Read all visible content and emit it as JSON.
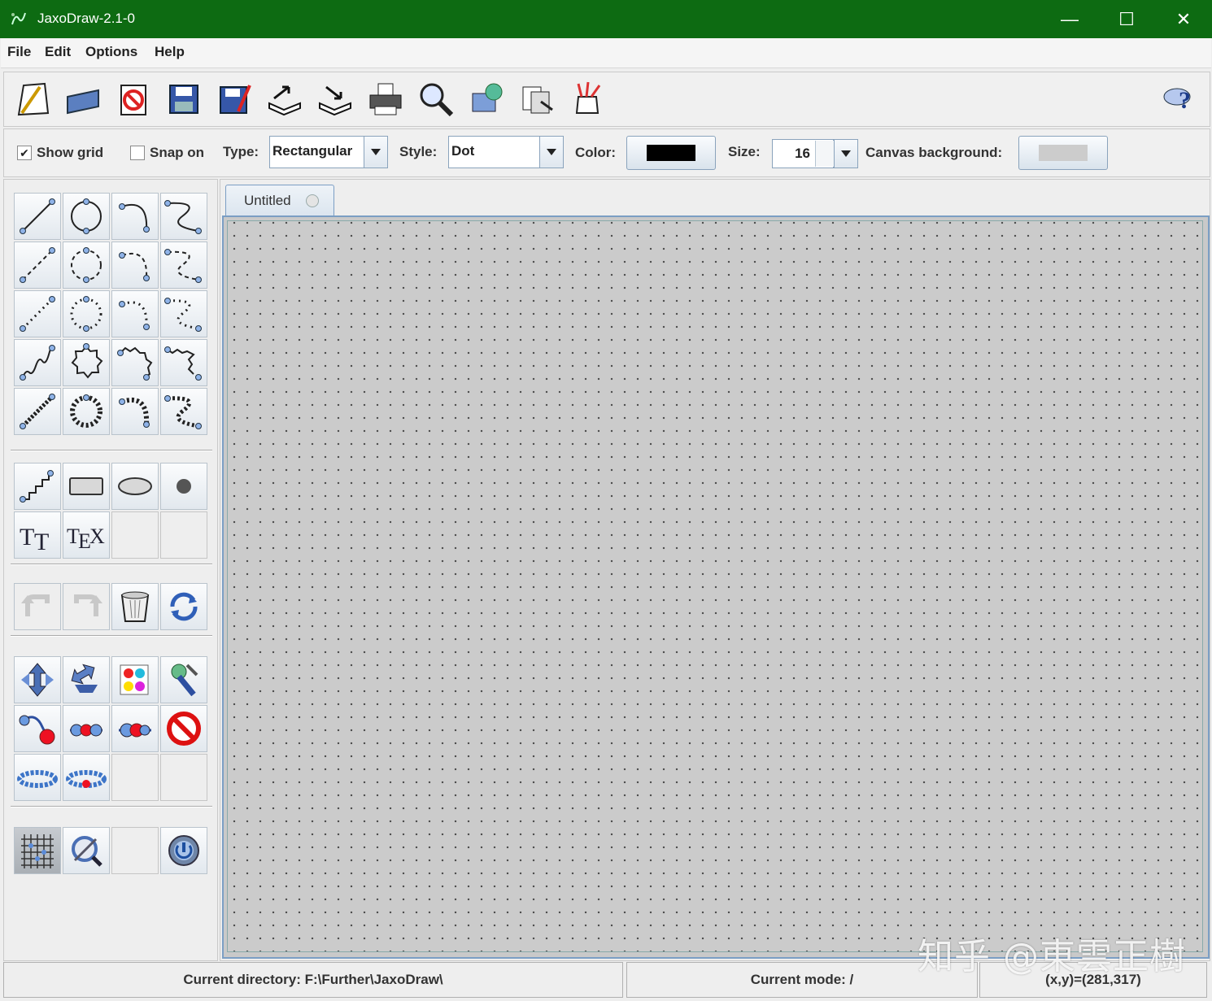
{
  "window": {
    "title": "JaxoDraw-2.1-0",
    "minimize": "—",
    "maximize": "☐",
    "close": "✕"
  },
  "menu": {
    "file": "File",
    "edit": "Edit",
    "options": "Options",
    "help": "Help"
  },
  "toolbar": {
    "icons": [
      "new-icon",
      "open-icon",
      "close-icon",
      "save-icon",
      "save-as-icon",
      "export-icon",
      "import-icon",
      "print-icon",
      "preview-icon",
      "package-icon",
      "update-icon",
      "edit-icon"
    ],
    "help_icon": "help-icon"
  },
  "options": {
    "show_grid_label": "Show grid",
    "show_grid_checked": "✔",
    "snap_on_label": "Snap on",
    "snap_on_checked": "",
    "type_label": "Type:",
    "type_value": "Rectangular",
    "style_label": "Style:",
    "style_value": "Dot",
    "color_label": "Color:",
    "color_value": "#000000",
    "size_label": "Size:",
    "size_value": "16",
    "canvas_bg_label": "Canvas background:",
    "canvas_bg_value": "#cccccc"
  },
  "tab": {
    "title": "Untitled"
  },
  "status": {
    "directory": "Current directory: F:\\Further\\JaxoDraw\\",
    "mode": "Current mode: /",
    "coords": "(x,y)=(281,317)"
  },
  "watermark": "知乎 @東雲正樹",
  "colors": {
    "titlebar": "#0d6b12",
    "canvas": "#cbcbcb",
    "accent": "#7b9ec4"
  }
}
